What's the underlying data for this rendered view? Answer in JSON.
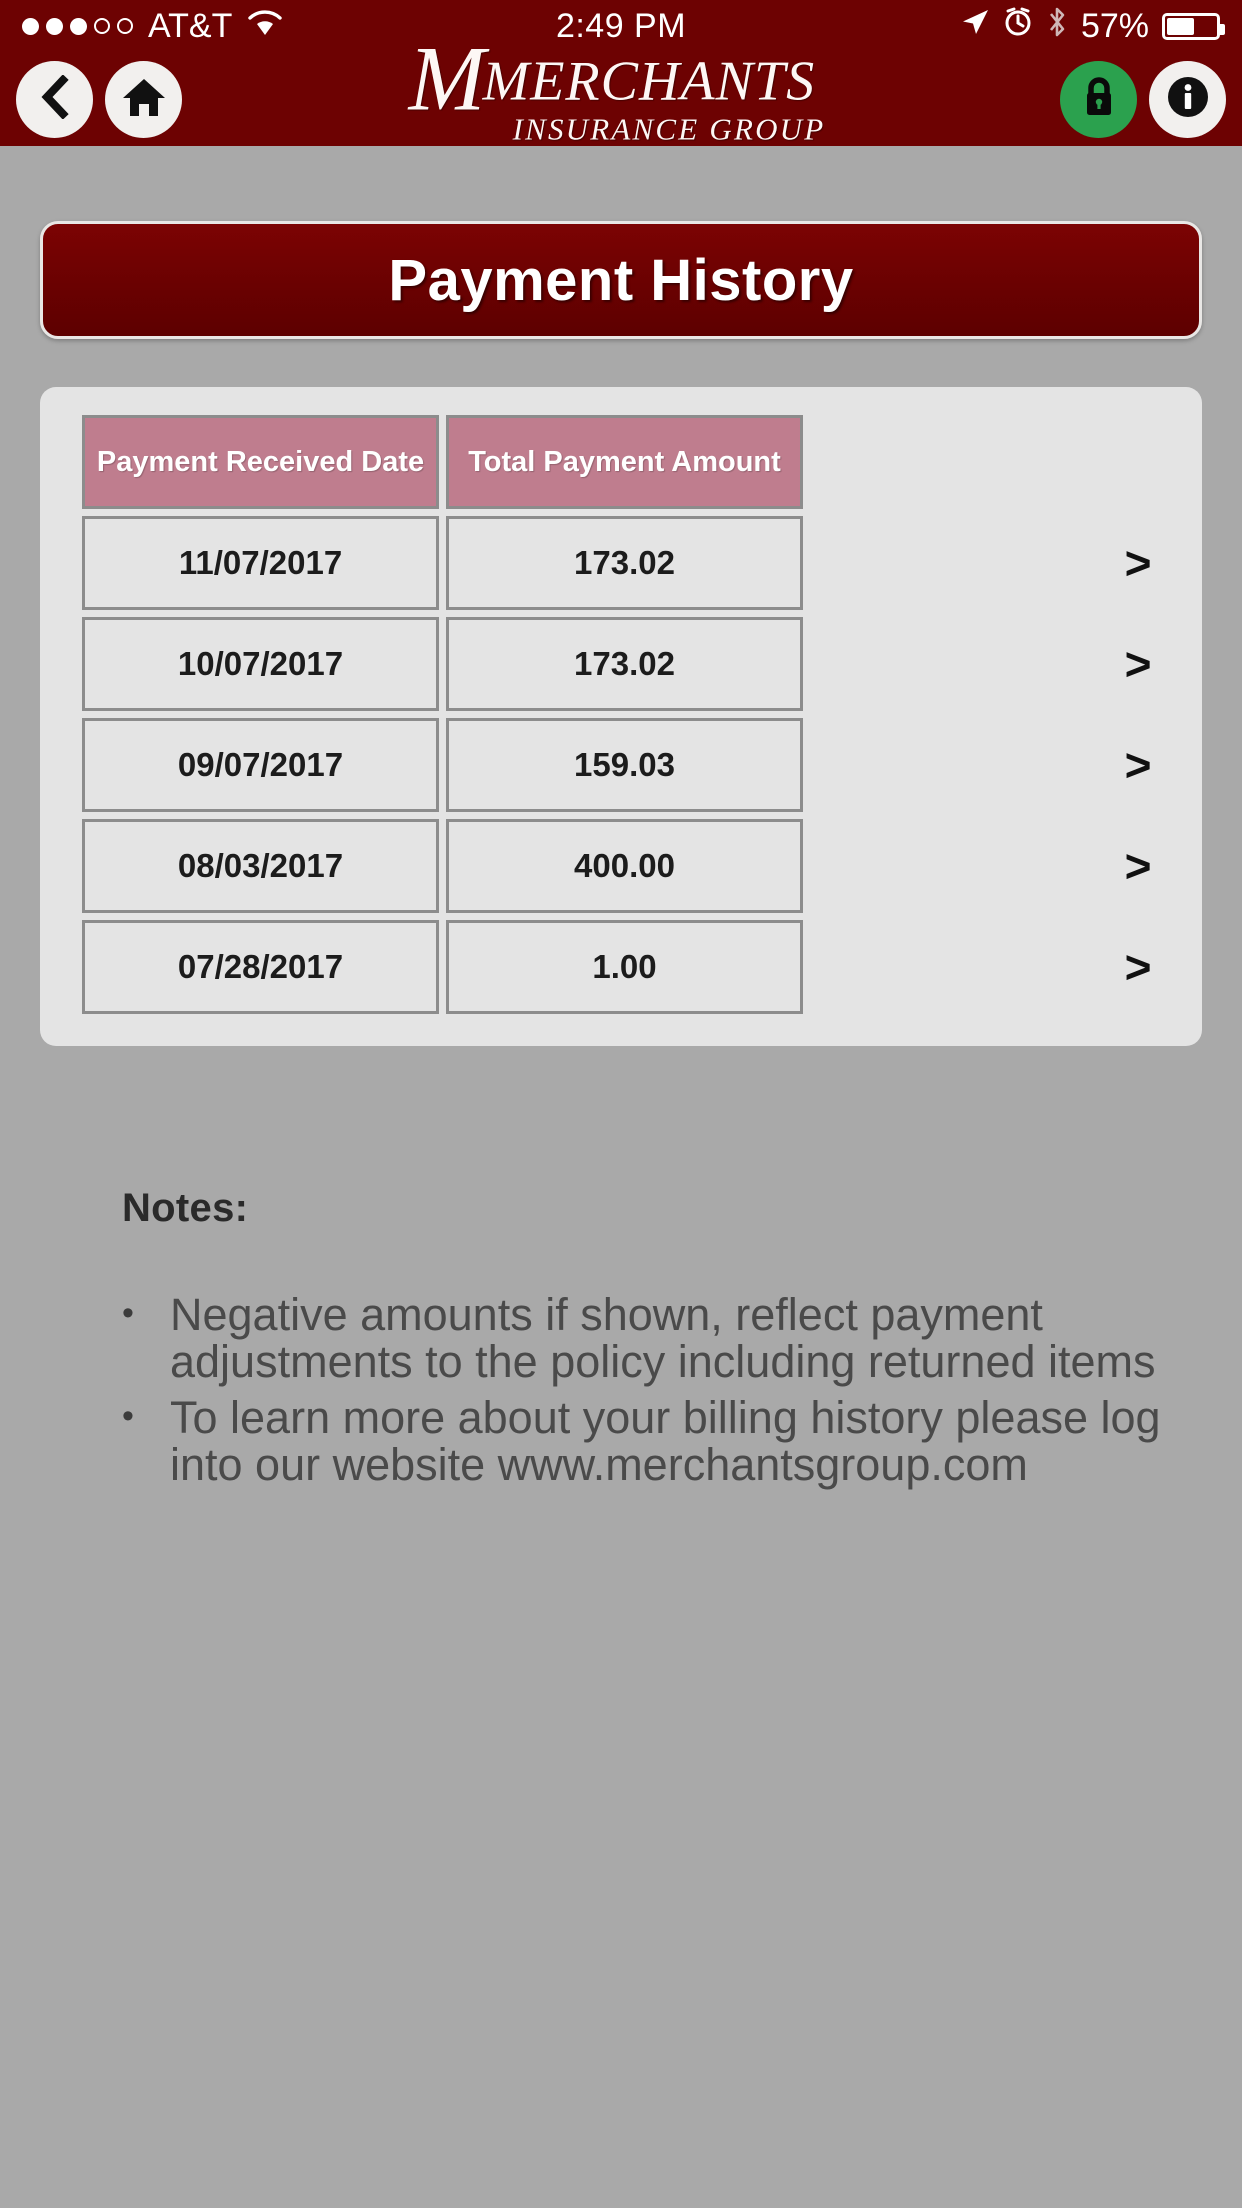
{
  "status_bar": {
    "carrier": "AT&T",
    "signal_dots_filled": 3,
    "signal_dots_total": 5,
    "wifi_icon": "wifi-icon",
    "time": "2:49 PM",
    "location_icon": "location-arrow-icon",
    "alarm_icon": "alarm-clock-icon",
    "bluetooth_icon": "bluetooth-icon",
    "battery_percent": "57%",
    "battery_level": 57
  },
  "header": {
    "back_icon": "back-chevron-icon",
    "home_icon": "home-icon",
    "lock_icon": "lock-icon",
    "info_icon": "info-icon",
    "logo": {
      "monogram": "M",
      "name": "MERCHANTS",
      "tagline": "INSURANCE GROUP"
    },
    "colors": {
      "bar": "#6d0202",
      "lock_button": "#2ba14e",
      "button": "#f2f0ee"
    }
  },
  "page": {
    "title": "Payment History",
    "title_colors": {
      "background": "#6a0101",
      "text": "#ffffff"
    }
  },
  "table": {
    "columns": [
      "Payment Received Date",
      "Total Payment Amount"
    ],
    "header_color": "#bf7d8e",
    "row_color": "#e4e4e4",
    "detail_chevron": ">",
    "rows": [
      {
        "date": "11/07/2017",
        "amount": "173.02",
        "chevron": ">"
      },
      {
        "date": "10/07/2017",
        "amount": "173.02",
        "chevron": ">"
      },
      {
        "date": "09/07/2017",
        "amount": "159.03",
        "chevron": ">"
      },
      {
        "date": "08/03/2017",
        "amount": "400.00",
        "chevron": ">"
      },
      {
        "date": "07/28/2017",
        "amount": "1.00",
        "chevron": ">"
      }
    ]
  },
  "notes": {
    "heading": "Notes:",
    "bullet": "•",
    "items": [
      "Negative amounts if shown, reflect payment adjustments to the policy including returned items",
      "To learn more about your billing history please log into our website www.merchantsgroup.com"
    ]
  }
}
